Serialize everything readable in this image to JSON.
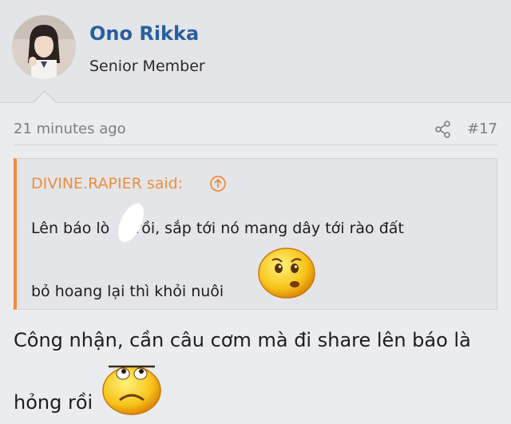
{
  "user": {
    "name": "Ono Rikka",
    "title": "Senior Member"
  },
  "post": {
    "time": "21 minutes ago",
    "number": "#17"
  },
  "quote": {
    "attribution": "DIVINE.RAPIER said:",
    "line1": "Lên báo lò",
    "line1_rest": "u rồi, sắp tới nó mang dây tới rào đất",
    "line2": "bỏ hoang lại thì khỏi nuôi"
  },
  "reply": {
    "line1": "Công nhận, cần câu cơm mà đi share lên báo là",
    "line2": "hỏng rồi"
  },
  "icons": {
    "share": "share-icon",
    "quote_jump": "arrow-up-circle-icon",
    "emoji_quote": "worried-emoji-icon",
    "emoji_reply": "sad-emoji-icon"
  },
  "colors": {
    "username": "#2a5f9e",
    "quote_accent": "#f08d3c",
    "meta_text": "#7b7e84",
    "background": "#ebecee"
  }
}
